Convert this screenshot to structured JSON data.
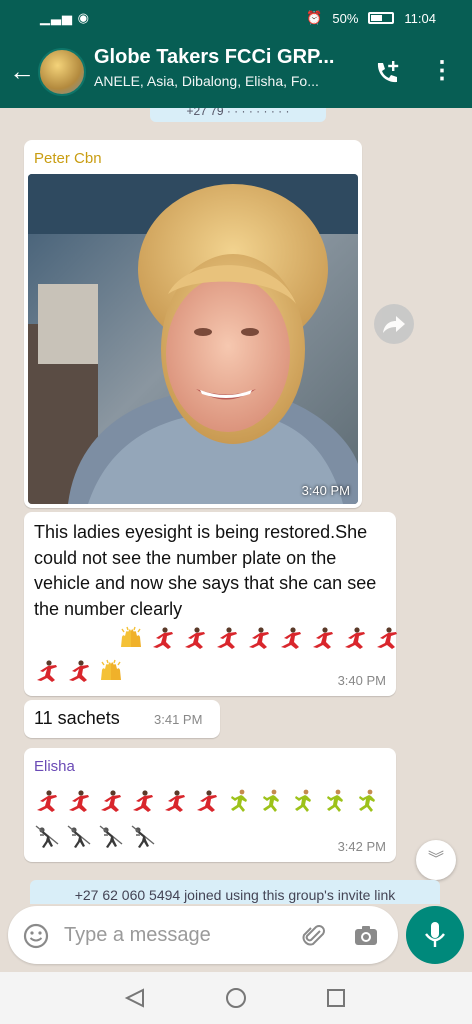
{
  "status_bar": {
    "battery": "50%",
    "time": "11:04"
  },
  "header": {
    "title": "Globe Takers FCCi GRP...",
    "subtitle": "ANELE, Asia, Dibalong, Elisha, Fo..."
  },
  "messages": [
    {
      "sender": "Peter Cbn",
      "sender_color": "#c99d12",
      "type": "image",
      "time": "3:40 PM"
    },
    {
      "type": "text",
      "text": "This ladies eyesight is being restored.She could not see the number plate on the vehicle and now she says that she can see the number clearly",
      "time": "3:40 PM"
    },
    {
      "type": "text",
      "text": "11 sachets",
      "time": "3:41 PM"
    },
    {
      "sender": "Elisha",
      "sender_color": "#6b4bb6",
      "type": "emoji",
      "time": "3:42 PM"
    }
  ],
  "system_message": "+27 62 060 5494 joined using this group's invite link",
  "composer": {
    "placeholder": "Type a message"
  },
  "colors": {
    "header_bg": "#075e54",
    "chat_bg": "#e5ddd5",
    "bubble_bg": "#ffffff",
    "system_bg": "#d9eef8",
    "mic_bg": "#00897b"
  },
  "icons": [
    "back-arrow-icon",
    "add-call-icon",
    "more-vert-icon",
    "forward-icon",
    "chevron-down-icon",
    "smiley-icon",
    "attach-icon",
    "camera-icon",
    "mic-icon",
    "nav-back-icon",
    "nav-home-icon",
    "nav-recents-icon"
  ]
}
